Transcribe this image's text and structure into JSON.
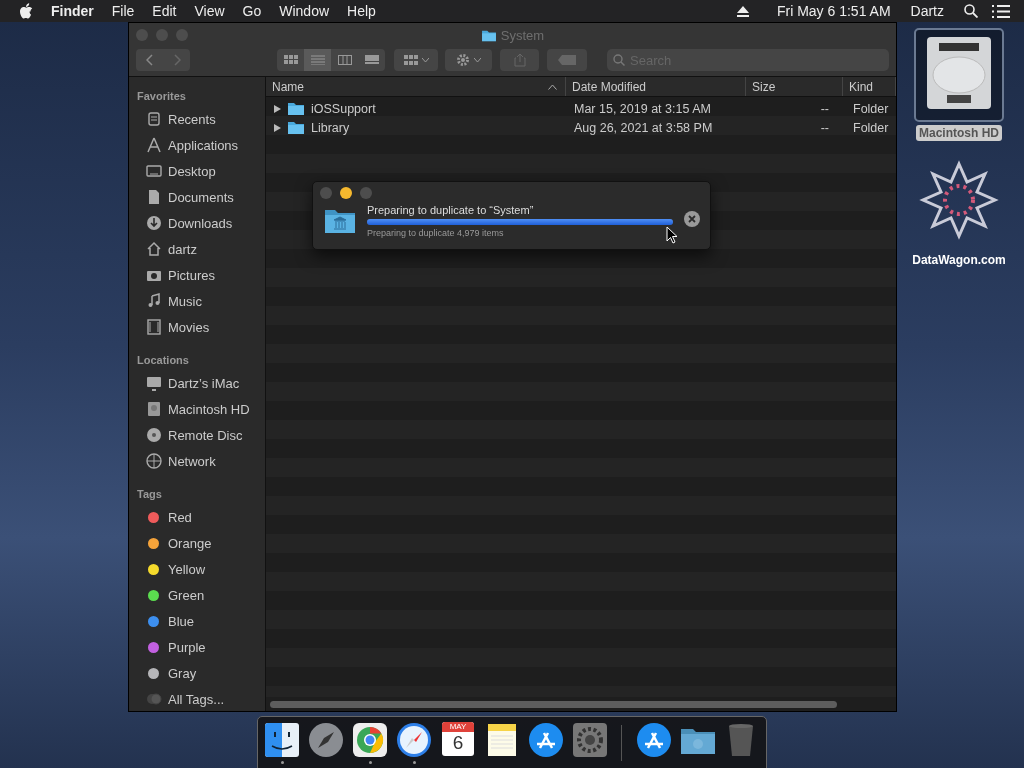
{
  "menu_bar": {
    "menus": [
      {
        "label": "Finder",
        "bold": true
      },
      {
        "label": "File",
        "bold": false
      },
      {
        "label": "Edit",
        "bold": false
      },
      {
        "label": "View",
        "bold": false
      },
      {
        "label": "Go",
        "bold": false
      },
      {
        "label": "Window",
        "bold": false
      },
      {
        "label": "Help",
        "bold": false
      }
    ],
    "clock": "Fri May 6  1:51 AM",
    "user": "Dartz"
  },
  "window": {
    "title": "System",
    "toolbar": {
      "views": [
        {
          "selected": false
        },
        {
          "selected": true
        },
        {
          "selected": false
        },
        {
          "selected": false
        }
      ],
      "search": {
        "placeholder": "Search"
      }
    },
    "sidebar": [
      {
        "heading": "Favorites",
        "items": [
          {
            "label": "Recents"
          },
          {
            "label": "Applications"
          },
          {
            "label": "Desktop"
          },
          {
            "label": "Documents"
          },
          {
            "label": "Downloads"
          },
          {
            "label": "dartz"
          },
          {
            "label": "Pictures"
          },
          {
            "label": "Music"
          },
          {
            "label": "Movies"
          }
        ]
      },
      {
        "heading": "Locations",
        "items": [
          {
            "label": "Dartz’s iMac"
          },
          {
            "label": "Macintosh HD"
          },
          {
            "label": "Remote Disc"
          },
          {
            "label": "Network"
          }
        ]
      },
      {
        "heading": "Tags",
        "items": [
          {
            "label": "Red",
            "color": "#ef5b5b"
          },
          {
            "label": "Orange",
            "color": "#f5a33a"
          },
          {
            "label": "Yellow",
            "color": "#f5da2c"
          },
          {
            "label": "Green",
            "color": "#5bdc4f"
          },
          {
            "label": "Blue",
            "color": "#3d8fef"
          },
          {
            "label": "Purple",
            "color": "#c260e0"
          },
          {
            "label": "Gray",
            "color": "#b5b5b8"
          },
          {
            "label": "All Tags..."
          }
        ]
      }
    ],
    "table": {
      "columns": [
        {
          "label": "Name",
          "sorted": true
        },
        {
          "label": "Date Modified",
          "sorted": false
        },
        {
          "label": "Size",
          "sorted": false
        },
        {
          "label": "Kind",
          "sorted": false
        }
      ],
      "rows": [
        {
          "name": "iOSSupport",
          "date": "Mar 15, 2019 at 3:15 AM",
          "size": "--",
          "kind": "Folder",
          "expanded": false
        },
        {
          "name": "Library",
          "date": "Aug 26, 2021 at 3:58 PM",
          "size": "--",
          "kind": "Folder",
          "expanded": false
        }
      ]
    }
  },
  "progress_dialog": {
    "title": "Preparing to duplicate to “System”",
    "level": 1,
    "detail": "Preparing to duplicate 4,979 items"
  },
  "desktop_icons": [
    {
      "label": "Macintosh HD",
      "selected": true
    },
    {
      "label": "DataWagon.com",
      "selected": false
    }
  ],
  "dock": {
    "apps": [
      {
        "running": true
      },
      {
        "running": false
      },
      {
        "running": true
      },
      {
        "running": true
      },
      {
        "running": false,
        "month": "MAY",
        "day": "6"
      },
      {
        "running": false
      },
      {
        "running": false
      },
      {
        "running": false
      }
    ]
  }
}
